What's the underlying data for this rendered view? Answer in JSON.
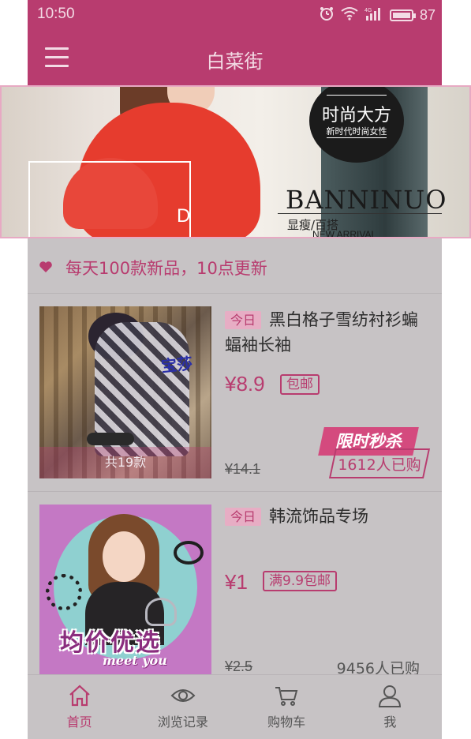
{
  "status_bar": {
    "time": "10:50",
    "network": "4G",
    "battery": "87"
  },
  "header": {
    "title": "白菜街"
  },
  "banner": {
    "badge_title": "时尚大方",
    "badge_subtitle": "新时代时尚女性",
    "brand": "BANNINUO",
    "brand_subtitle": "显瘦/百搭",
    "brand_tagline": "NEW ARRIVAL",
    "inset_letters": "D"
  },
  "notice": {
    "text": "每天100款新品，10点更新"
  },
  "products": [
    {
      "today_tag": "今日",
      "title": "黑白格子雪纺衬衫蝙蝠袖长袖",
      "price": "¥8.9",
      "shipping_tag": "包邮",
      "original_price": "¥14.1",
      "flash_badge": "限时秒杀",
      "sold": "1612人已购",
      "thumb_overlay": "共19款",
      "thumb_brandmark": "宝莎"
    },
    {
      "today_tag": "今日",
      "title": "韩流饰品专场",
      "price": "¥1",
      "shipping_tag": "满9.9包邮",
      "original_price": "¥2.5",
      "sold": "9456人已购",
      "thumb_slogan": "均价优选",
      "thumb_slogan_sub": "meet you"
    }
  ],
  "tabbar": {
    "items": [
      {
        "label": "首页",
        "icon": "home-icon",
        "active": true
      },
      {
        "label": "浏览记录",
        "icon": "eye-icon",
        "active": false
      },
      {
        "label": "购物车",
        "icon": "cart-icon",
        "active": false
      },
      {
        "label": "我",
        "icon": "user-icon",
        "active": false
      }
    ]
  },
  "colors": {
    "brand": "#b83c6f",
    "dim_overlay": "#c7c3c5"
  }
}
